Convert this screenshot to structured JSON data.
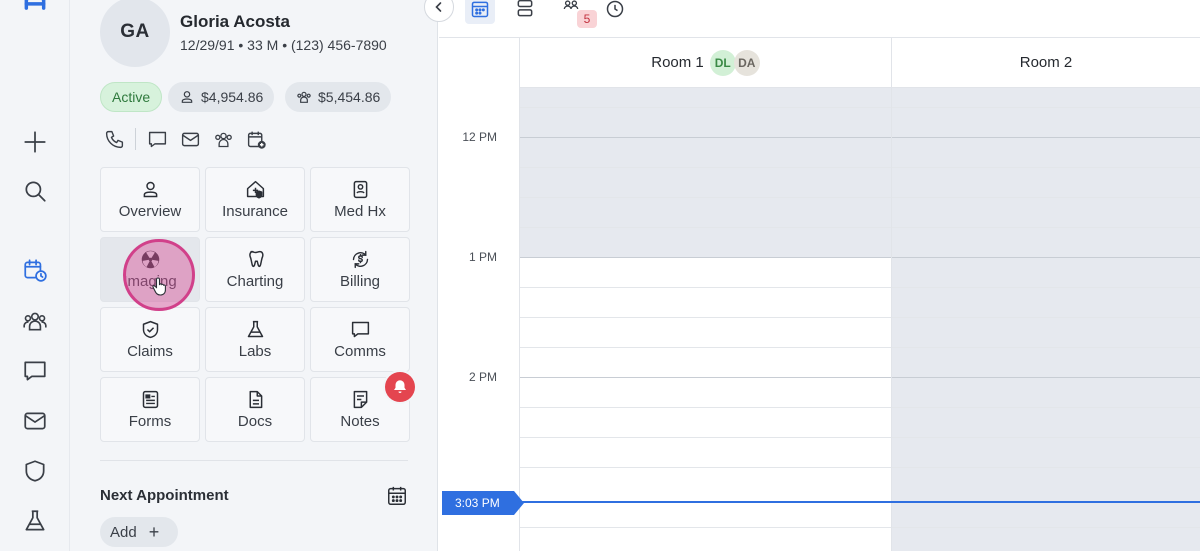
{
  "patient": {
    "initials": "GA",
    "name": "Gloria Acosta",
    "info": "12/29/91 • 33 M • (123) 456-7890",
    "status": "Active",
    "patient_balance": "$4,954.86",
    "family_balance": "$5,454.86"
  },
  "tiles": [
    {
      "label": "Overview",
      "icon": "user-icon"
    },
    {
      "label": "Insurance",
      "icon": "insurance-icon"
    },
    {
      "label": "Med Hx",
      "icon": "medical-history-icon"
    },
    {
      "label": "Imaging",
      "icon": "radiation-icon"
    },
    {
      "label": "Charting",
      "icon": "tooth-icon"
    },
    {
      "label": "Billing",
      "icon": "billing-icon"
    },
    {
      "label": "Claims",
      "icon": "shield-check-icon"
    },
    {
      "label": "Labs",
      "icon": "flask-icon"
    },
    {
      "label": "Comms",
      "icon": "chat-icon"
    },
    {
      "label": "Forms",
      "icon": "form-icon"
    },
    {
      "label": "Docs",
      "icon": "document-icon"
    },
    {
      "label": "Notes",
      "icon": "note-icon"
    }
  ],
  "next_appointment": {
    "title": "Next Appointment",
    "add_label": "Add"
  },
  "toolbar": {
    "badge_count": "5"
  },
  "schedule": {
    "rooms": [
      {
        "name": "Room 1",
        "providers": [
          "DL",
          "DA"
        ]
      },
      {
        "name": "Room 2",
        "providers": []
      }
    ],
    "time_labels": [
      "12 PM",
      "1 PM",
      "2 PM"
    ],
    "current_time": "3:03 PM"
  },
  "colors": {
    "accent": "#2f6fe0",
    "active_green": "#d7f2dc",
    "alert_red": "#e4454f",
    "cursor_pink": "#d1408a"
  }
}
